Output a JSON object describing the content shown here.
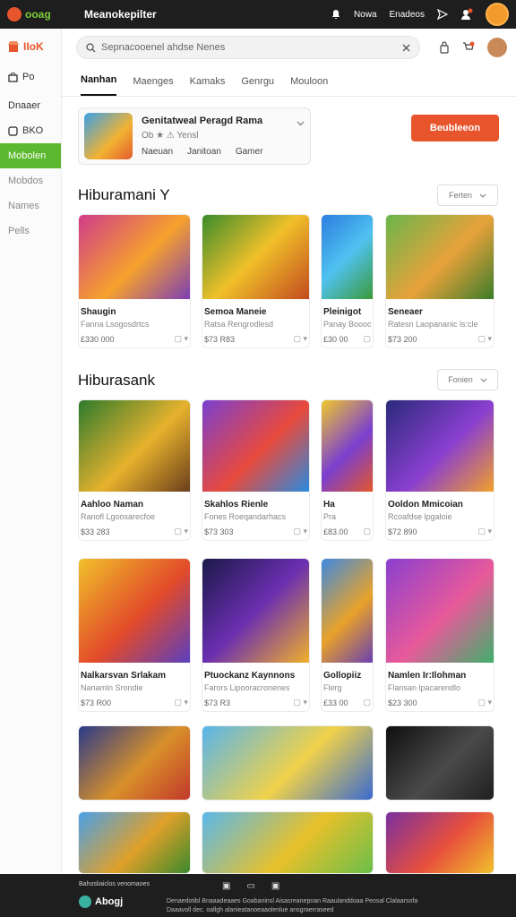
{
  "topbar": {
    "logo_text": "ooag",
    "app_title": "Meanokepilter",
    "links": [
      "Nowa",
      "Enadeos"
    ]
  },
  "sidebar": {
    "brand": "IIoK",
    "items": [
      {
        "label": "Po",
        "icon": "bag-icon"
      },
      {
        "label": "Dnaaer",
        "icon": ""
      },
      {
        "label": "BKO",
        "icon": "box-icon"
      },
      {
        "label": "Mobolen",
        "icon": "",
        "active": true
      },
      {
        "label": "Mobdos",
        "icon": ""
      },
      {
        "label": "Names",
        "icon": ""
      },
      {
        "label": "Pells",
        "icon": ""
      }
    ]
  },
  "search": {
    "value": "Sepnacooenel ahdse Nenes"
  },
  "tabs": [
    "Nanhan",
    "Maenges",
    "Kamaks",
    "Genrgu",
    "Mouloon"
  ],
  "featured": {
    "title": "Genitatweal Peragd Rama",
    "rating_text": "Ob ★ ⚠ Yensl",
    "links": [
      "Naeuan",
      "Janitoan",
      "Gamer"
    ]
  },
  "cta_label": "Beubleeon",
  "sections": [
    {
      "title": "Hiburamani Y",
      "sort_label": "Ferten"
    },
    {
      "title": "Hiburasank",
      "sort_label": "Fonien"
    }
  ],
  "cards": [
    {
      "name": "Shaugin",
      "sub": "Fanna Lsogosdrtcs",
      "price": "£330 000"
    },
    {
      "name": "Semoa Maneie",
      "sub": "Ratsa Rengrodlesd",
      "price": "$73 R83"
    },
    {
      "name": "Pleinigot",
      "sub": "Panay Boooot",
      "price": "£30 00"
    },
    {
      "name": "Seneaer",
      "sub": "Ratesn Laopananic ls:cle",
      "price": "$73 200"
    },
    {
      "name": "Aahloo Naman",
      "sub": "Ranofl Lgoosarecfoe",
      "price": "$33 283"
    },
    {
      "name": "Skahlos Rienle",
      "sub": "Fones Roeqandarhacs",
      "price": "$73 303"
    },
    {
      "name": "Ha",
      "sub": "Pra",
      "price": "£83.00"
    },
    {
      "name": "Ooldon Mmicoian",
      "sub": "Rcoafdse lpgaloie",
      "price": "$72 890"
    },
    {
      "name": "Nalkarsvan Srlakam",
      "sub": "Nanamln Srondie",
      "price": "$73 R00"
    },
    {
      "name": "Ptuockanz Kaynnons",
      "sub": "Farors Lipooracronenes",
      "price": "$73 R3"
    },
    {
      "name": "Gollopiiz",
      "sub": "Flerg",
      "price": "£33 00"
    },
    {
      "name": "Namlen Ir:Ilohman",
      "sub": "Flansan lpacarendlo",
      "price": "$23 300"
    }
  ],
  "footer": {
    "line1": "Bahosliaiclos venomaoes",
    "brand": "Abogj",
    "legal": "Denaedotibl  Bnaaadeaaes  Goabaninsl  Aisasreanepnan  Raaulanddoaa  Peosal Clalaarsofa Daaavoll dec. oallgh alanieatanoeaaolenlue ansgraerraseed"
  }
}
